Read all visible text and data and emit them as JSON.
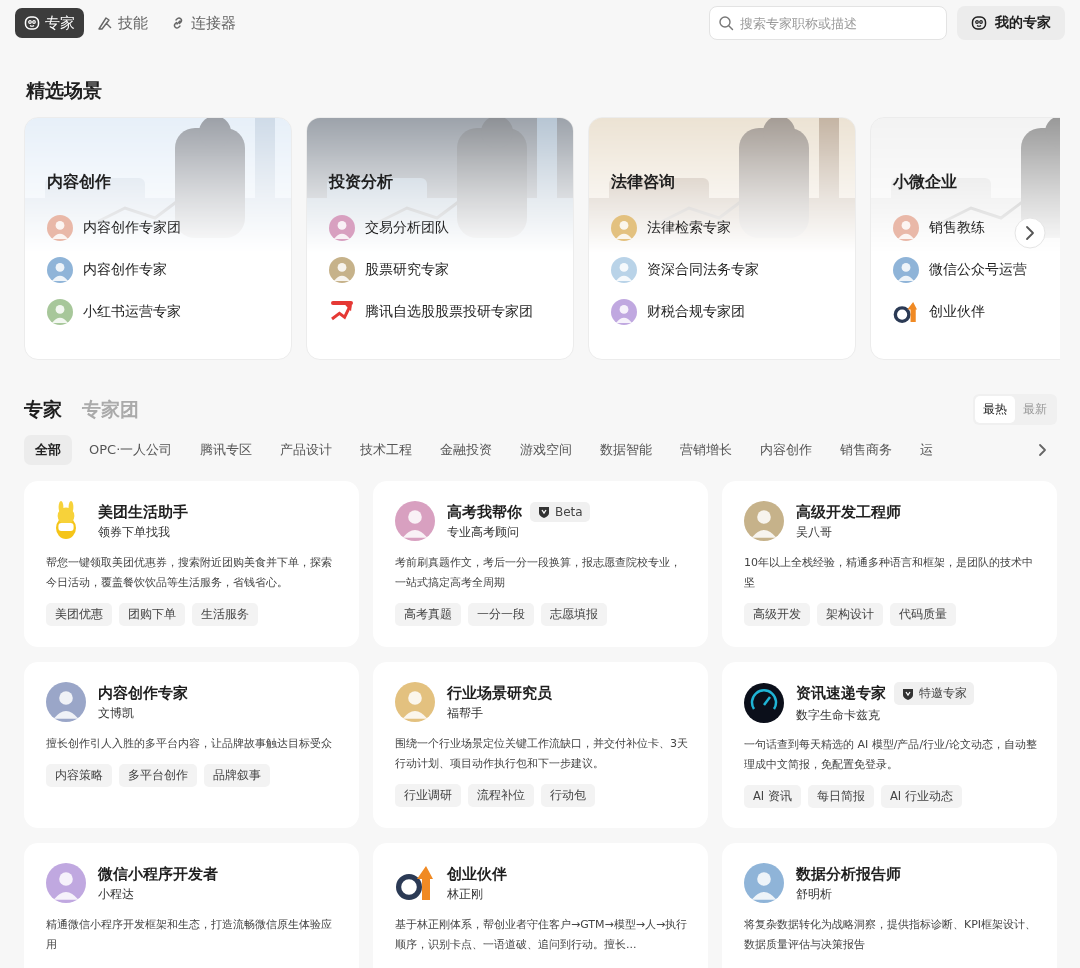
{
  "nav": {
    "tabs": [
      {
        "label": "专家",
        "kind": "face",
        "selected": true
      },
      {
        "label": "技能",
        "kind": "skill",
        "selected": false
      },
      {
        "label": "连接器",
        "kind": "link",
        "selected": false
      }
    ],
    "search": {
      "placeholder": "搜索专家职称或描述"
    },
    "my_button": "我的专家"
  },
  "featured": {
    "title": "精选场景",
    "scenarios": [
      {
        "title": "内容创作",
        "items": [
          {
            "label": "内容创作专家团",
            "kind": "avatar"
          },
          {
            "label": "内容创作专家",
            "kind": "avatar"
          },
          {
            "label": "小红书运营专家",
            "kind": "avatar"
          }
        ]
      },
      {
        "title": "投资分析",
        "items": [
          {
            "label": "交易分析团队",
            "kind": "avatar"
          },
          {
            "label": "股票研究专家",
            "kind": "avatar"
          },
          {
            "label": "腾讯自选股股票投研专家团",
            "kind": "chart"
          }
        ]
      },
      {
        "title": "法律咨询",
        "items": [
          {
            "label": "法律检索专家",
            "kind": "avatar"
          },
          {
            "label": "资深合同法务专家",
            "kind": "avatar"
          },
          {
            "label": "财税合规专家团",
            "kind": "avatar"
          }
        ]
      },
      {
        "title": "小微企业",
        "items": [
          {
            "label": "销售教练",
            "kind": "avatar"
          },
          {
            "label": "微信公众号运营",
            "kind": "avatar"
          },
          {
            "label": "创业伙伴",
            "kind": "brand"
          }
        ]
      }
    ]
  },
  "experts": {
    "tabs": [
      {
        "label": "专家",
        "selected": true
      },
      {
        "label": "专家团",
        "selected": false
      }
    ],
    "sort": [
      {
        "label": "最热",
        "selected": true
      },
      {
        "label": "最新",
        "selected": false
      }
    ],
    "categories": [
      {
        "label": "全部",
        "selected": true
      },
      {
        "label": "OPC·一人公司",
        "selected": false
      },
      {
        "label": "腾讯专区",
        "selected": false
      },
      {
        "label": "产品设计",
        "selected": false
      },
      {
        "label": "技术工程",
        "selected": false
      },
      {
        "label": "金融投资",
        "selected": false
      },
      {
        "label": "游戏空间",
        "selected": false
      },
      {
        "label": "数据智能",
        "selected": false
      },
      {
        "label": "营销增长",
        "selected": false
      },
      {
        "label": "内容创作",
        "selected": false
      },
      {
        "label": "销售商务",
        "selected": false
      },
      {
        "label": "运",
        "selected": false
      }
    ],
    "cards": [
      {
        "name": "美团生活助手",
        "subtitle": "领券下单找我",
        "kind": "mascot",
        "description": "帮您一键领取美团优惠券，搜索附近团购美食并下单，探索今日活动，覆盖餐饮饮品等生活服务，省钱省心。",
        "tags": [
          "美团优惠",
          "团购下单",
          "生活服务"
        ]
      },
      {
        "name": "高考我帮你",
        "subtitle": "专业高考顾问",
        "kind": "avatar",
        "badge": "Beta",
        "description": "考前刷真题作文，考后一分一段换算，报志愿查院校专业，一站式搞定高考全周期",
        "tags": [
          "高考真题",
          "一分一段",
          "志愿填报"
        ]
      },
      {
        "name": "高级开发工程师",
        "subtitle": "吴八哥",
        "kind": "avatar",
        "description": "10年以上全栈经验，精通多种语言和框架，是团队的技术中坚",
        "tags": [
          "高级开发",
          "架构设计",
          "代码质量"
        ]
      },
      {
        "name": "内容创作专家",
        "subtitle": "文博凯",
        "kind": "avatar",
        "description": "擅长创作引人入胜的多平台内容，让品牌故事触达目标受众",
        "tags": [
          "内容策略",
          "多平台创作",
          "品牌叙事"
        ]
      },
      {
        "name": "行业场景研究员",
        "subtitle": "福帮手",
        "kind": "avatar",
        "description": "围绕一个行业场景定位关键工作流缺口，并交付补位卡、3天行动计划、项目动作执行包和下一步建议。",
        "tags": [
          "行业调研",
          "流程补位",
          "行动包"
        ]
      },
      {
        "name": "资讯速递专家",
        "subtitle": "数字生命卡兹克",
        "kind": "gauge",
        "badge": "特邀专家",
        "description": "一句话查到每天精选的 AI 模型/产品/行业/论文动态，自动整理成中文简报，免配置免登录。",
        "tags": [
          "AI 资讯",
          "每日简报",
          "AI 行业动态"
        ]
      },
      {
        "name": "微信小程序开发者",
        "subtitle": "小程达",
        "kind": "avatar",
        "description": "精通微信小程序开发框架和生态，打造流畅微信原生体验应用"
      },
      {
        "name": "创业伙伴",
        "subtitle": "林正刚",
        "kind": "brand",
        "description": "基于林正刚体系，帮创业者守住客户→GTM→模型→人→执行顺序，识别卡点、一语道破、追问到行动。擅长..."
      },
      {
        "name": "数据分析报告师",
        "subtitle": "舒明析",
        "kind": "avatar",
        "description": "将复杂数据转化为战略洞察，提供指标诊断、KPI框架设计、数据质量评估与决策报告"
      }
    ]
  }
}
